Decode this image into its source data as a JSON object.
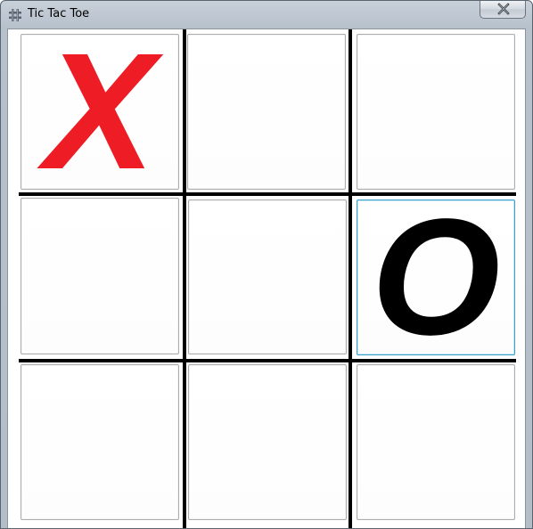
{
  "window": {
    "title": "Tic Tac Toe",
    "icon": "grid-hash-icon",
    "close_icon": "close-icon"
  },
  "board": {
    "cells": [
      {
        "mark": "X"
      },
      {
        "mark": ""
      },
      {
        "mark": ""
      },
      {
        "mark": ""
      },
      {
        "mark": ""
      },
      {
        "mark": "O"
      },
      {
        "mark": ""
      },
      {
        "mark": ""
      },
      {
        "mark": ""
      }
    ],
    "focused_cell": 5
  },
  "colors": {
    "x_mark": "#ee1c25",
    "o_mark": "#000000",
    "grid_lines": "#000000",
    "focus_border": "#3c9fc9"
  }
}
